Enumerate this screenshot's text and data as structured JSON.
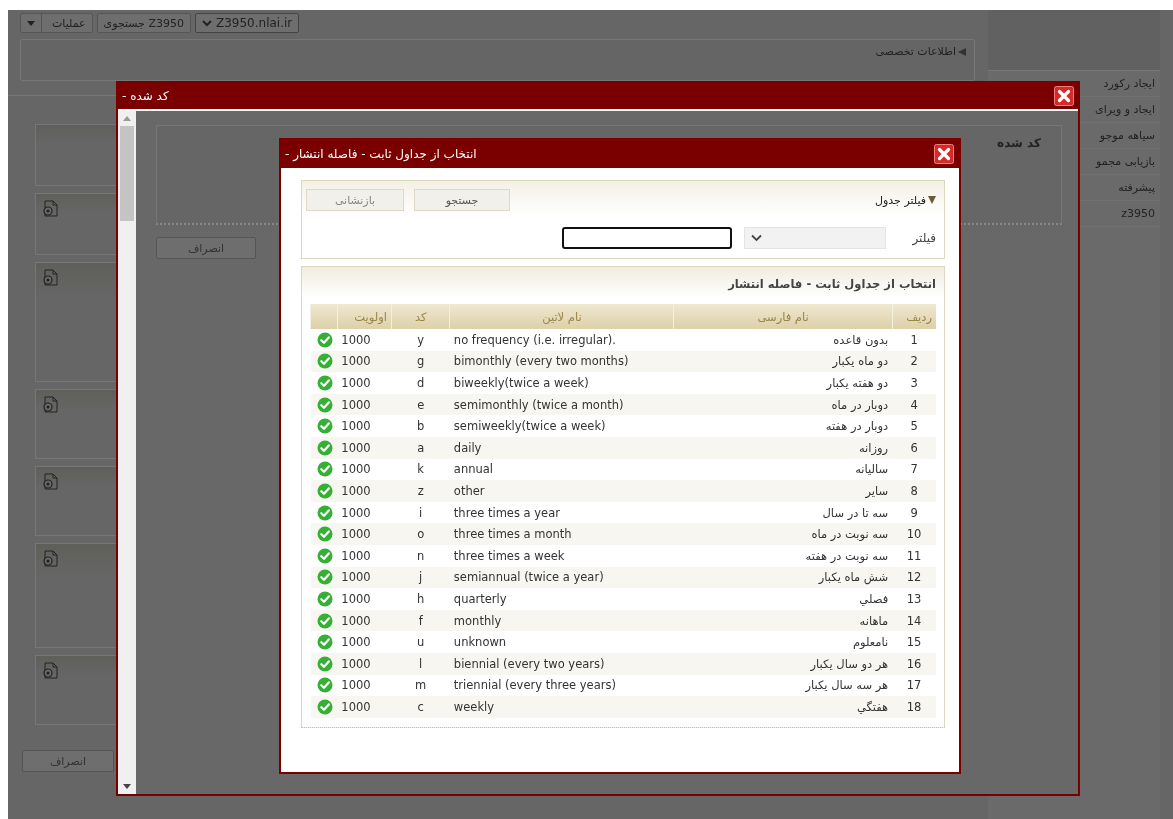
{
  "toolbar": {
    "operations_button": "عملیات",
    "z3950_search_button": "جستجوی Z3950",
    "server_select": "Z3950.nlai.ir"
  },
  "specialized_info": {
    "label": "اطلاعات تخصصی",
    "expanded": false
  },
  "sidebar": {
    "items": [
      "ایجاد رکورد",
      "ایجاد و ویرای",
      "سیاهه موجو",
      "بازیابی مجمو",
      "پیشرفته",
      "z3950"
    ]
  },
  "cancel_button": "انصراف",
  "coded_dialog": {
    "title": "کد شده -",
    "field_label": "کد شده",
    "cancel_button": "انصراف"
  },
  "picker_dialog": {
    "title": "انتخاب از جداول ثابت - فاصله انتشار -",
    "filter_panel": {
      "title": "فیلتر جدول",
      "expanded": true,
      "search_button": "جستجو",
      "reset_button": "بازنشانی",
      "filter_label": "فیلتر"
    },
    "table": {
      "title": "انتخاب از جداول ثابت - فاصله انتشار",
      "columns": [
        "ردیف",
        "نام فارسی",
        "نام لاتین",
        "کد",
        "اولویت"
      ],
      "rows": [
        {
          "number": "1",
          "persian_name": "بدون قاعده",
          "latin_name": "no frequency (i.e. irregular).",
          "code": "y",
          "priority": "1000"
        },
        {
          "number": "2",
          "persian_name": "دو ماه یکبار",
          "latin_name": "bimonthly (every two months)",
          "code": "g",
          "priority": "1000"
        },
        {
          "number": "3",
          "persian_name": "دو هفته یکبار",
          "latin_name": "biweekly(twice a week)",
          "code": "d",
          "priority": "1000"
        },
        {
          "number": "4",
          "persian_name": "دوبار در ماه",
          "latin_name": "semimonthly (twice a month)",
          "code": "e",
          "priority": "1000"
        },
        {
          "number": "5",
          "persian_name": "دوبار در هفته",
          "latin_name": "semiweekly(twice a week)",
          "code": "b",
          "priority": "1000"
        },
        {
          "number": "6",
          "persian_name": "روزانه",
          "latin_name": "daily",
          "code": "a",
          "priority": "1000"
        },
        {
          "number": "7",
          "persian_name": "سالیانه",
          "latin_name": "annual",
          "code": "k",
          "priority": "1000"
        },
        {
          "number": "8",
          "persian_name": "سایر",
          "latin_name": "other",
          "code": "z",
          "priority": "1000"
        },
        {
          "number": "9",
          "persian_name": "سه تا در سال",
          "latin_name": "three times a year",
          "code": "i",
          "priority": "1000"
        },
        {
          "number": "10",
          "persian_name": "سه نوبت در ماه",
          "latin_name": "three times a month",
          "code": "o",
          "priority": "1000"
        },
        {
          "number": "11",
          "persian_name": "سه نوبت در هفته",
          "latin_name": "three times a week",
          "code": "n",
          "priority": "1000"
        },
        {
          "number": "12",
          "persian_name": "شش ماه یکبار",
          "latin_name": "semiannual (twice a year)",
          "code": "j",
          "priority": "1000"
        },
        {
          "number": "13",
          "persian_name": "فصلي",
          "latin_name": "quarterly",
          "code": "h",
          "priority": "1000"
        },
        {
          "number": "14",
          "persian_name": "ماهانه",
          "latin_name": "monthly",
          "code": "f",
          "priority": "1000"
        },
        {
          "number": "15",
          "persian_name": "نامعلوم",
          "latin_name": "unknown",
          "code": "u",
          "priority": "1000"
        },
        {
          "number": "16",
          "persian_name": "هر دو سال یکبار",
          "latin_name": "biennial (every two years)",
          "code": "l",
          "priority": "1000"
        },
        {
          "number": "17",
          "persian_name": "هر سه سال یکبار",
          "latin_name": "triennial (every three years)",
          "code": "m",
          "priority": "1000"
        },
        {
          "number": "18",
          "persian_name": "هفتگي",
          "latin_name": "weekly",
          "code": "c",
          "priority": "1000"
        }
      ]
    }
  }
}
